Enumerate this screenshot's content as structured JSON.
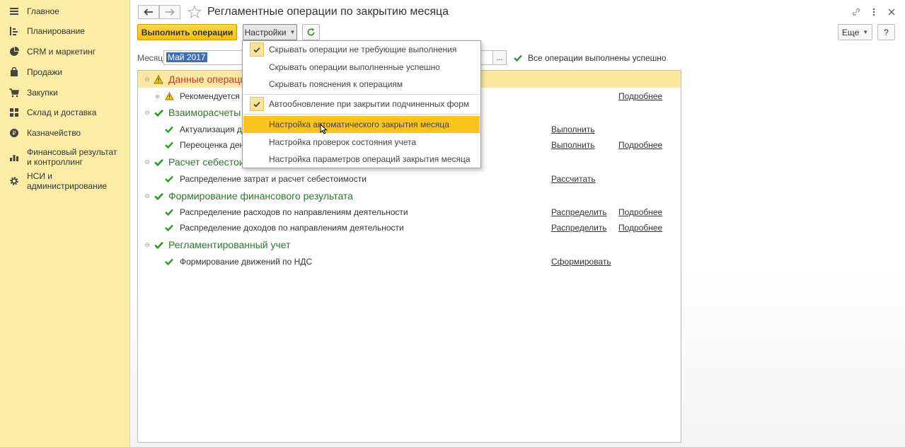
{
  "sidebar": {
    "items": [
      {
        "label": "Главное",
        "icon": "menu-icon"
      },
      {
        "label": "Планирование",
        "icon": "planning-icon"
      },
      {
        "label": "CRM и маркетинг",
        "icon": "pie-chart-icon"
      },
      {
        "label": "Продажи",
        "icon": "bag-icon"
      },
      {
        "label": "Закупки",
        "icon": "cart-icon"
      },
      {
        "label": "Склад и доставка",
        "icon": "warehouse-icon"
      },
      {
        "label": "Казначейство",
        "icon": "coin-icon"
      },
      {
        "label": "Финансовый результат и контроллинг",
        "icon": "bar-chart-icon"
      },
      {
        "label": "НСИ и администрирование",
        "icon": "gear-icon"
      }
    ]
  },
  "header": {
    "title": "Регламентные операции по закрытию месяца"
  },
  "toolbar": {
    "execute_label": "Выполнить операции",
    "settings_label": "Настройки",
    "more_label": "Еще",
    "help_label": "?"
  },
  "period": {
    "label": "Месяц:",
    "value": "Май 2017",
    "select_label": "...",
    "status": "Все операции выполнены успешно"
  },
  "settings_menu": {
    "items": [
      {
        "label": "Скрывать операции не требующие выполнения",
        "checked": true
      },
      {
        "label": "Скрывать операции выполненные успешно",
        "checked": false
      },
      {
        "label": "Скрывать пояснения к операциям",
        "checked": false
      },
      {
        "label": "Автообновление при закрытии подчиненных форм",
        "checked": true
      },
      {
        "label": "Настройка автоматического закрытия месяца",
        "checked": false,
        "highlighted": true
      },
      {
        "label": "Настройка проверок состояния учета",
        "checked": false
      },
      {
        "label": "Настройка параметров операций закрытия месяца",
        "checked": false
      }
    ]
  },
  "operations": {
    "groups": [
      {
        "title": "Данные операций",
        "status": "warning",
        "items": [
          {
            "text": "Рекомендуется ос",
            "status": "warning",
            "action": "",
            "details": "Подробнее"
          }
        ]
      },
      {
        "title": "Взаиморасчеты и",
        "status": "ok",
        "items": [
          {
            "text": "Актуализация движ",
            "status": "ok",
            "action": "Выполнить",
            "details": ""
          },
          {
            "text": "Переоценка денеж",
            "status": "ok",
            "action": "Выполнить",
            "details": "Подробнее"
          }
        ]
      },
      {
        "title": "Расчет себестоим",
        "status": "ok",
        "items": [
          {
            "text": "Распределение затрат и расчет себестоимости",
            "status": "ok",
            "action": "Рассчитать",
            "details": ""
          }
        ]
      },
      {
        "title": "Формирование финансового результата",
        "status": "ok",
        "items": [
          {
            "text": "Распределение расходов по направлениям деятельности",
            "status": "ok",
            "action": "Распределить",
            "details": "Подробнее"
          },
          {
            "text": "Распределение доходов по направлениям деятельности",
            "status": "ok",
            "action": "Распределить",
            "details": "Подробнее"
          }
        ]
      },
      {
        "title": "Регламентированный учет",
        "status": "ok",
        "items": [
          {
            "text": "Формирование движений по НДС",
            "status": "ok",
            "action": "Сформировать",
            "details": ""
          }
        ]
      }
    ]
  },
  "colors": {
    "sidebar_bg": "#fbeda6",
    "accent_yellow": "#f3be11",
    "highlight": "#fcc21f",
    "ok_green": "#2a9a2a",
    "warning_red": "#c0392b"
  }
}
